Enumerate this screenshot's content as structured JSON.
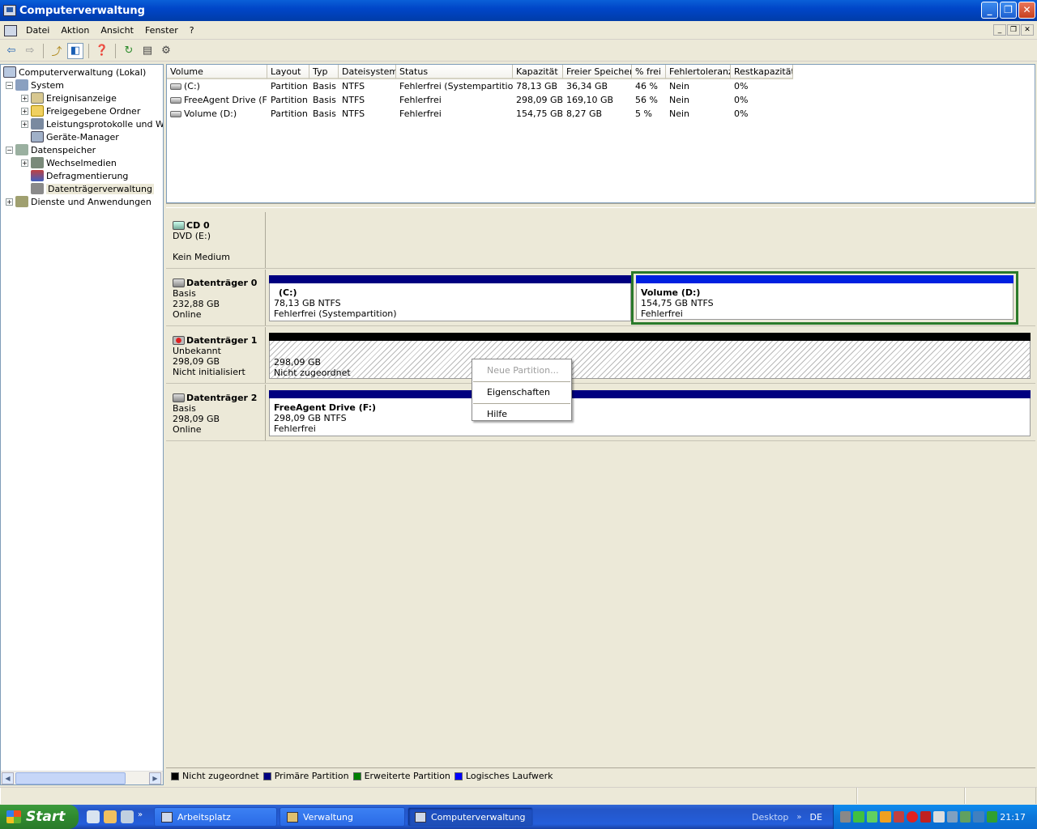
{
  "window": {
    "title": "Computerverwaltung"
  },
  "menu": [
    "Datei",
    "Aktion",
    "Ansicht",
    "Fenster",
    "?"
  ],
  "tree": {
    "root": "Computerverwaltung (Lokal)",
    "system": "System",
    "event_viewer": "Ereignisanzeige",
    "shared_folders": "Freigegebene Ordner",
    "perf_logs": "Leistungsprotokolle und Warn",
    "device_manager": "Geräte-Manager",
    "storage": "Datenspeicher",
    "removable": "Wechselmedien",
    "defrag": "Defragmentierung",
    "disk_mgmt": "Datenträgerverwaltung",
    "services": "Dienste und Anwendungen"
  },
  "volume_table": {
    "columns": [
      "Volume",
      "Layout",
      "Typ",
      "Dateisystem",
      "Status",
      "Kapazität",
      "Freier Speicher",
      "% frei",
      "Fehlertoleranz",
      "Restkapazität"
    ],
    "rows": [
      [
        "(C:)",
        "Partition",
        "Basis",
        "NTFS",
        "Fehlerfrei (Systempartition)",
        "78,13 GB",
        "36,34 GB",
        "46 %",
        "Nein",
        "0%"
      ],
      [
        "FreeAgent Drive (F:)",
        "Partition",
        "Basis",
        "NTFS",
        "Fehlerfrei",
        "298,09 GB",
        "169,10 GB",
        "56 %",
        "Nein",
        "0%"
      ],
      [
        "Volume (D:)",
        "Partition",
        "Basis",
        "NTFS",
        "Fehlerfrei",
        "154,75 GB",
        "8,27 GB",
        "5 %",
        "Nein",
        "0%"
      ]
    ]
  },
  "disks": {
    "cd0": {
      "name": "CD 0",
      "line1": "DVD (E:)",
      "line2": "",
      "line3": "Kein Medium"
    },
    "d0": {
      "name": "Datenträger 0",
      "line1": "Basis",
      "line2": "232,88 GB",
      "line3": "Online",
      "p1": {
        "name": "(C:)",
        "size": "78,13 GB NTFS",
        "status": "Fehlerfrei (Systempartition)"
      },
      "p2": {
        "name": "Volume  (D:)",
        "size": "154,75 GB NTFS",
        "status": "Fehlerfrei"
      }
    },
    "d1": {
      "name": "Datenträger 1",
      "line1": "Unbekannt",
      "line2": "298,09 GB",
      "line3": "Nicht initialisiert",
      "p1": {
        "size": "298,09 GB",
        "status": "Nicht zugeordnet"
      }
    },
    "d2": {
      "name": "Datenträger 2",
      "line1": "Basis",
      "line2": "298,09 GB",
      "line3": "Online",
      "p1": {
        "name": "FreeAgent Drive  (F:)",
        "size": "298,09 GB NTFS",
        "status": "Fehlerfrei"
      }
    }
  },
  "context_menu": {
    "new_partition": "Neue Partition...",
    "properties": "Eigenschaften",
    "help": "Hilfe"
  },
  "legend": {
    "unallocated": "Nicht zugeordnet",
    "primary": "Primäre Partition",
    "extended": "Erweiterte Partition",
    "logical": "Logisches Laufwerk"
  },
  "colors": {
    "unallocated": "#000000",
    "primary": "#000080",
    "extended": "#008000",
    "logical": "#0000ff"
  },
  "taskbar": {
    "start": "Start",
    "tasks": [
      "Arbeitsplatz",
      "Verwaltung",
      "Computerverwaltung"
    ],
    "desktop": "Desktop",
    "lang": "DE",
    "clock": "21:17"
  }
}
